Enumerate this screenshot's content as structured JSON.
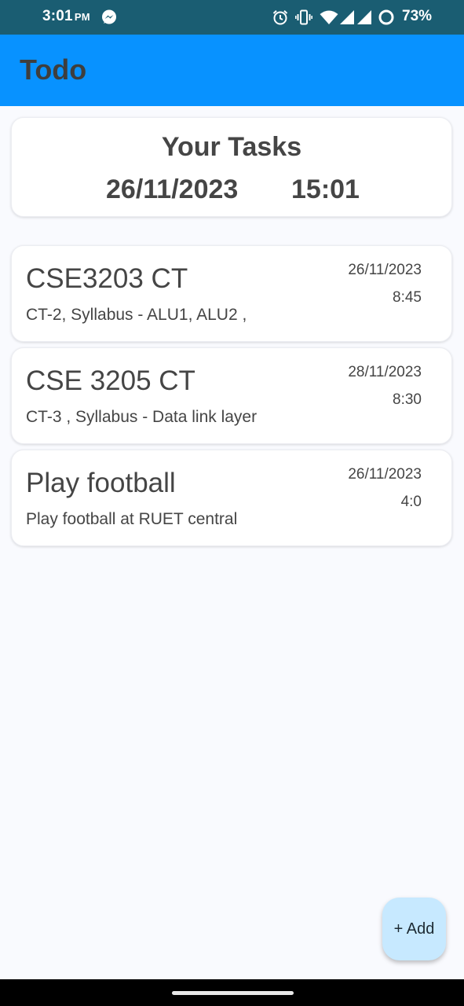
{
  "status_bar": {
    "time": "3:01",
    "ampm": "PM",
    "battery_percent": "73%",
    "icons": [
      "messenger-icon",
      "alarm-icon",
      "vibrate-icon",
      "wifi-icon",
      "signal-icon",
      "signal-icon",
      "battery-icon"
    ]
  },
  "app_bar": {
    "title": "Todo",
    "background": "#0892ff"
  },
  "header": {
    "title": "Your Tasks",
    "date": "26/11/2023",
    "time": "15:01"
  },
  "tasks": [
    {
      "title": "CSE3203 CT",
      "description": "CT-2, Syllabus - ALU1, ALU2 ,",
      "date": "26/11/2023",
      "time": "8:45"
    },
    {
      "title": "CSE 3205 CT",
      "description": "CT-3 , Syllabus - Data link layer",
      "date": "28/11/2023",
      "time": "8:30"
    },
    {
      "title": "Play football",
      "description": "Play football at RUET central",
      "date": "26/11/2023",
      "time": "4:0"
    }
  ],
  "fab": {
    "label": "+ Add",
    "background": "#c7e9ff"
  }
}
